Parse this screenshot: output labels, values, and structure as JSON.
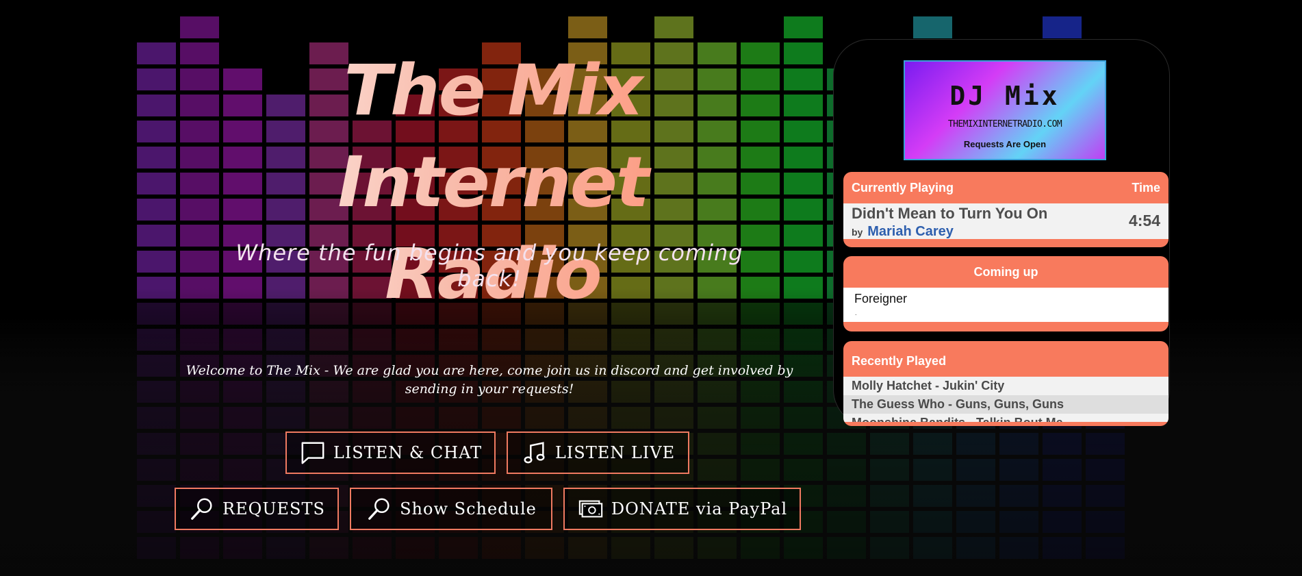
{
  "hero": {
    "title_line1": "The Mix",
    "title_line2": "Internet Radio",
    "tagline": "Where the fun begins and you keep coming back!",
    "welcome": "Welcome to The Mix - We are glad you are here, come join us in discord and get involved by sending in your requests!"
  },
  "buttons": {
    "listen_chat": "LISTEN & CHAT",
    "listen_live": "LISTEN LIVE",
    "requests": "REQUESTS",
    "schedule": "Show Schedule",
    "donate": "DONATE via PayPal"
  },
  "dj_card": {
    "title": "DJ Mix",
    "site": "THEMIXINTERNETRADIO.COM",
    "status": "Requests Are Open"
  },
  "now_playing": {
    "heading": "Currently Playing",
    "time_heading": "Time",
    "song": "Didn't Mean to Turn You On",
    "by_label": "by",
    "artist": "Mariah Carey",
    "duration": "4:54"
  },
  "coming_up": {
    "heading": "Coming up",
    "item": "Foreigner",
    "marker": "."
  },
  "recently_played": {
    "heading": "Recently Played",
    "items": [
      "Molly Hatchet - Jukin' City",
      "The Guess Who - Guns, Guns, Guns",
      "Moonshine Bandits - Talkin Bout Me"
    ]
  },
  "colors": {
    "accent": "#f87a5d",
    "button_border": "#f07a61",
    "artist_link": "#2e5fae",
    "dj_card_border": "#39a0d8"
  },
  "icons": {
    "listen_chat": "speech-bubble-icon",
    "listen_live": "music-note-icon",
    "requests": "magnifier-icon",
    "schedule": "magnifier-icon",
    "donate": "money-icon"
  }
}
